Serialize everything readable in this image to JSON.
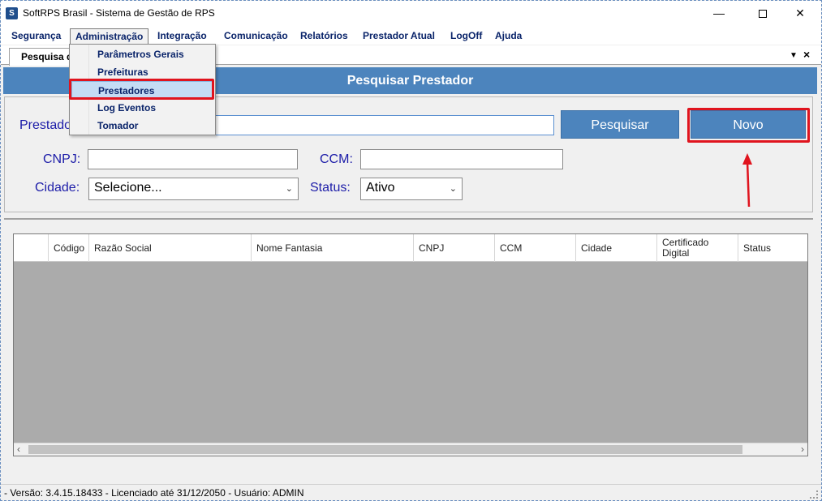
{
  "window": {
    "title": "SoftRPS Brasil - Sistema de Gestão de RPS",
    "icon_letter": "S",
    "minimize": "—",
    "close": "✕"
  },
  "menubar": {
    "items": [
      "Segurança",
      "Administração",
      "Integração",
      "Comunicação",
      "Relatórios",
      "Prestador Atual",
      "LogOff",
      "Ajuda"
    ]
  },
  "dropdown": {
    "items": [
      "Parâmetros Gerais",
      "Prefeituras",
      "Prestadores",
      "Log Eventos",
      "Tomador"
    ],
    "selected_index": 2
  },
  "tab": {
    "label": "Pesquisa de"
  },
  "header": {
    "title": "Pesquisar Prestador"
  },
  "search": {
    "prestador_label": "Prestador:",
    "prestador_value": "",
    "cnpj_label": "CNPJ:",
    "cnpj_value": "",
    "ccm_label": "CCM:",
    "ccm_value": "",
    "cidade_label": "Cidade:",
    "cidade_selected": "Selecione...",
    "status_label": "Status:",
    "status_selected": "Ativo",
    "pesquisar_button": "Pesquisar",
    "novo_button": "Novo"
  },
  "grid": {
    "columns": [
      "Código",
      "Razão Social",
      "Nome Fantasia",
      "CNPJ",
      "CCM",
      "Cidade",
      "Certificado Digital",
      "Status"
    ],
    "rows": []
  },
  "statusbar": {
    "text": "- Versão: 3.4.15.18433 - Licenciado até 31/12/2050 - Usuário: ADMIN"
  },
  "colors": {
    "accent_blue": "#4c84bd",
    "menu_text": "#0a246a",
    "highlight_red": "#e0141e",
    "label_blue": "#1c1ca8"
  }
}
